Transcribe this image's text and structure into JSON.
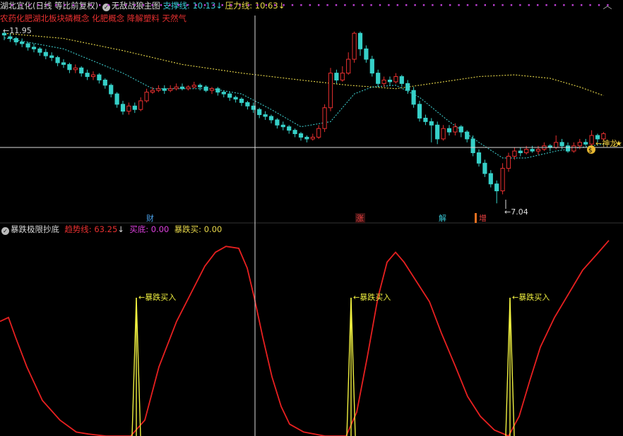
{
  "header": {
    "stock": "湖北宜化(日线 等比前复权)",
    "indicator": "无敌战狼主图",
    "support_label": "支撑线:",
    "support_value": "10.13",
    "resist_label": "压力线:",
    "resist_value": "10.63",
    "concepts": "农药化肥湖北板块磷概念 化肥概念 降解塑料 天然气"
  },
  "sub_header": {
    "indicator": "暴跌极限抄底",
    "trend_label": "趋势线:",
    "trend_value": "63.25",
    "bottom_label": "买底:",
    "bottom_value": "0.00",
    "crash_label": "暴跌买:",
    "crash_value": "0.00"
  },
  "annotations": {
    "high": "11.95",
    "low": "7.04",
    "dragon": "神龙",
    "star": "★",
    "event_cai": "财",
    "event_zhang": "涨",
    "event_jie": "解",
    "event_zeng": "增",
    "crash_buy": "暴跌买入",
    "dollar": "$"
  },
  "colors": {
    "up": "#e83030",
    "down": "#36d0c8",
    "ma_short": "#3cc8c8",
    "ma_long": "#e8d84a",
    "trend": "#e82020",
    "crash": "#f0f040"
  },
  "chart_data": [
    {
      "type": "candlestick",
      "title": "无敌战狼主图",
      "ylim": [
        6.8,
        12.3
      ],
      "candles": [
        [
          11.95,
          11.9,
          12.0,
          11.75
        ],
        [
          11.85,
          11.8,
          11.95,
          11.7
        ],
        [
          11.8,
          11.7,
          11.85,
          11.6
        ],
        [
          11.7,
          11.65,
          11.8,
          11.55
        ],
        [
          11.65,
          11.55,
          11.7,
          11.45
        ],
        [
          11.55,
          11.5,
          11.65,
          11.4
        ],
        [
          11.5,
          11.4,
          11.55,
          11.3
        ],
        [
          11.4,
          11.3,
          11.5,
          11.2
        ],
        [
          11.3,
          11.25,
          11.4,
          11.15
        ],
        [
          11.25,
          11.1,
          11.3,
          11.0
        ],
        [
          11.1,
          11.05,
          11.2,
          10.95
        ],
        [
          11.05,
          10.9,
          11.1,
          10.8
        ],
        [
          10.9,
          10.95,
          11.05,
          10.8
        ],
        [
          10.95,
          10.8,
          11.0,
          10.7
        ],
        [
          10.8,
          10.7,
          10.9,
          10.6
        ],
        [
          10.7,
          10.75,
          10.85,
          10.6
        ],
        [
          10.75,
          10.6,
          10.8,
          10.5
        ],
        [
          10.6,
          10.45,
          10.65,
          10.35
        ],
        [
          10.45,
          10.2,
          10.5,
          10.1
        ],
        [
          10.2,
          9.9,
          10.25,
          9.8
        ],
        [
          9.9,
          9.7,
          10.0,
          9.6
        ],
        [
          9.7,
          9.85,
          9.95,
          9.6
        ],
        [
          9.85,
          9.75,
          9.95,
          9.65
        ],
        [
          9.75,
          10.0,
          10.1,
          9.7
        ],
        [
          10.0,
          10.25,
          10.35,
          9.95
        ],
        [
          10.25,
          10.3,
          10.4,
          10.2
        ],
        [
          10.3,
          10.35,
          10.45,
          10.25
        ],
        [
          10.35,
          10.3,
          10.45,
          10.2
        ],
        [
          10.3,
          10.35,
          10.45,
          10.25
        ],
        [
          10.35,
          10.4,
          10.5,
          10.3
        ],
        [
          10.4,
          10.35,
          10.5,
          10.3
        ],
        [
          10.35,
          10.4,
          10.45,
          10.3
        ],
        [
          10.4,
          10.45,
          10.55,
          10.35
        ],
        [
          10.45,
          10.4,
          10.5,
          10.3
        ],
        [
          10.4,
          10.3,
          10.45,
          10.25
        ],
        [
          10.3,
          10.35,
          10.4,
          10.2
        ],
        [
          10.35,
          10.25,
          10.4,
          10.15
        ],
        [
          10.25,
          10.2,
          10.3,
          10.1
        ],
        [
          10.2,
          10.1,
          10.25,
          10.0
        ],
        [
          10.1,
          10.05,
          10.15,
          9.95
        ],
        [
          10.05,
          9.95,
          10.1,
          9.85
        ],
        [
          9.95,
          9.85,
          10.0,
          9.75
        ],
        [
          9.85,
          9.75,
          9.95,
          9.65
        ],
        [
          9.75,
          9.6,
          9.8,
          9.5
        ],
        [
          9.6,
          9.55,
          9.7,
          9.45
        ],
        [
          9.55,
          9.45,
          9.6,
          9.35
        ],
        [
          9.45,
          9.3,
          9.5,
          9.2
        ],
        [
          9.3,
          9.25,
          9.4,
          9.15
        ],
        [
          9.25,
          9.15,
          9.3,
          9.05
        ],
        [
          9.15,
          9.05,
          9.2,
          8.95
        ],
        [
          9.05,
          8.95,
          9.1,
          8.85
        ],
        [
          8.95,
          8.9,
          9.0,
          8.8
        ],
        [
          8.9,
          8.95,
          9.05,
          8.85
        ],
        [
          8.95,
          9.2,
          9.3,
          8.9
        ],
        [
          9.2,
          9.8,
          9.9,
          9.1
        ],
        [
          9.8,
          10.8,
          10.95,
          9.7
        ],
        [
          10.8,
          10.6,
          10.9,
          10.5
        ],
        [
          10.6,
          10.8,
          11.0,
          10.55
        ],
        [
          10.8,
          11.2,
          11.4,
          10.75
        ],
        [
          11.2,
          11.95,
          12.0,
          11.1
        ],
        [
          11.95,
          11.5,
          12.0,
          11.3
        ],
        [
          11.5,
          11.2,
          11.6,
          11.1
        ],
        [
          11.2,
          10.8,
          11.3,
          10.7
        ],
        [
          10.8,
          10.5,
          10.9,
          10.4
        ],
        [
          10.5,
          10.6,
          10.7,
          10.4
        ],
        [
          10.6,
          10.55,
          10.7,
          10.45
        ],
        [
          10.55,
          10.7,
          10.8,
          10.5
        ],
        [
          10.7,
          10.5,
          10.75,
          10.4
        ],
        [
          10.5,
          10.3,
          10.6,
          10.2
        ],
        [
          10.3,
          9.9,
          10.4,
          9.8
        ],
        [
          9.9,
          9.5,
          10.0,
          9.4
        ],
        [
          9.5,
          9.4,
          9.6,
          9.3
        ],
        [
          9.4,
          9.3,
          9.5,
          8.8
        ],
        [
          9.3,
          8.9,
          9.4,
          8.75
        ],
        [
          8.9,
          9.2,
          9.3,
          8.85
        ],
        [
          9.2,
          9.1,
          9.3,
          9.0
        ],
        [
          9.1,
          9.25,
          9.35,
          9.0
        ],
        [
          9.25,
          9.1,
          9.3,
          8.95
        ],
        [
          9.1,
          8.9,
          9.15,
          8.8
        ],
        [
          8.9,
          8.5,
          9.0,
          8.4
        ],
        [
          8.5,
          8.2,
          8.6,
          8.1
        ],
        [
          8.2,
          7.9,
          8.3,
          7.8
        ],
        [
          7.9,
          7.6,
          8.0,
          7.5
        ],
        [
          7.6,
          7.4,
          7.7,
          7.04
        ],
        [
          7.4,
          8.05,
          8.2,
          7.3
        ],
        [
          8.05,
          8.4,
          8.5,
          7.95
        ],
        [
          8.4,
          8.55,
          8.65,
          8.3
        ],
        [
          8.55,
          8.5,
          8.65,
          8.4
        ],
        [
          8.5,
          8.6,
          8.7,
          8.45
        ],
        [
          8.6,
          8.55,
          8.7,
          8.5
        ],
        [
          8.55,
          8.6,
          8.7,
          8.45
        ],
        [
          8.6,
          8.7,
          8.8,
          8.55
        ],
        [
          8.7,
          8.65,
          8.75,
          8.55
        ],
        [
          8.65,
          8.8,
          9.0,
          8.6
        ],
        [
          8.8,
          8.7,
          8.9,
          8.6
        ],
        [
          8.7,
          8.55,
          8.8,
          8.5
        ],
        [
          8.55,
          8.7,
          8.8,
          8.5
        ],
        [
          8.7,
          8.8,
          8.9,
          8.6
        ],
        [
          8.8,
          8.75,
          8.9,
          8.7
        ],
        [
          8.75,
          9.0,
          9.15,
          8.7
        ],
        [
          9.0,
          8.9,
          9.05,
          8.8
        ],
        [
          8.9,
          9.05,
          9.1,
          8.85
        ]
      ],
      "ma_short": [
        [
          0,
          11.82
        ],
        [
          10,
          11.5
        ],
        [
          20,
          10.8
        ],
        [
          25,
          10.35
        ],
        [
          30,
          10.35
        ],
        [
          35,
          10.35
        ],
        [
          40,
          10.2
        ],
        [
          45,
          9.75
        ],
        [
          50,
          9.25
        ],
        [
          55,
          9.4
        ],
        [
          59,
          10.2
        ],
        [
          62,
          10.4
        ],
        [
          66,
          10.45
        ],
        [
          70,
          10.1
        ],
        [
          75,
          9.4
        ],
        [
          80,
          8.8
        ],
        [
          84,
          8.35
        ],
        [
          88,
          8.35
        ],
        [
          93,
          8.55
        ],
        [
          101,
          8.75
        ]
      ],
      "ma_long": [
        [
          0,
          11.95
        ],
        [
          10,
          11.8
        ],
        [
          20,
          11.45
        ],
        [
          30,
          11.05
        ],
        [
          40,
          10.8
        ],
        [
          50,
          10.6
        ],
        [
          58,
          10.45
        ],
        [
          66,
          10.35
        ],
        [
          72,
          10.5
        ],
        [
          80,
          10.7
        ],
        [
          86,
          10.75
        ],
        [
          92,
          10.65
        ],
        [
          97,
          10.4
        ],
        [
          101,
          10.15
        ]
      ]
    },
    {
      "type": "line",
      "title": "暴跌极限抄底",
      "ylim": [
        0,
        100
      ],
      "series": [
        {
          "name": "趋势线",
          "values": []
        }
      ]
    }
  ]
}
